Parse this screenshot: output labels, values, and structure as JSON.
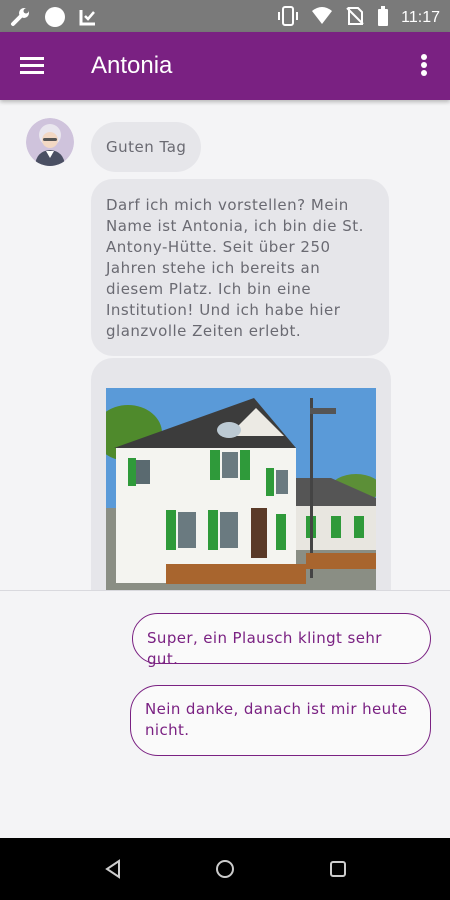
{
  "status_bar": {
    "time": "11:17",
    "left_icons": [
      "wrench-icon",
      "circle-icon",
      "checklist-icon"
    ],
    "right_icons": [
      "vibrate-icon",
      "wifi-icon",
      "no-sim-icon",
      "battery-icon"
    ]
  },
  "app_bar": {
    "title": "Antonia",
    "menu_icon": "hamburger-menu-icon",
    "overflow_icon": "more-vert-icon",
    "color": "#7a2182"
  },
  "chat": {
    "avatar": "antonia-avatar",
    "messages": [
      {
        "type": "text",
        "text": "Guten Tag"
      },
      {
        "type": "text",
        "text": "Darf ich mich vorstellen? Mein Name ist Antonia, ich bin die St. Antony-Hütte. Seit über 250 Jahren stehe ich bereits an diesem Platz. Ich bin eine Institution! Und ich habe hier glanzvolle Zeiten erlebt."
      },
      {
        "type": "image",
        "image": "st-antony-huette-photo"
      }
    ]
  },
  "quick_replies": [
    {
      "label": "Super, ein Plausch klingt sehr gut."
    },
    {
      "label": "Nein danke, danach ist mir heute nicht."
    }
  ],
  "nav_bar": {
    "icons": [
      "back-icon",
      "home-icon",
      "recents-icon"
    ]
  }
}
